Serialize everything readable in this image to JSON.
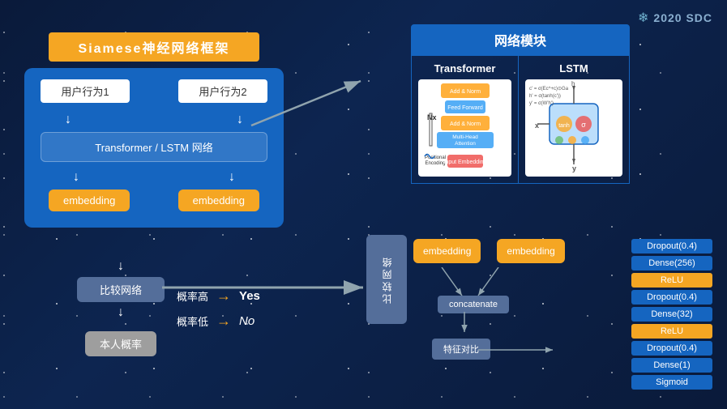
{
  "logo": {
    "icon": "❄",
    "text": "2020 SDC"
  },
  "left": {
    "siamese_title": "Siamese神经网络框架",
    "user1": "用户行为1",
    "user2": "用户行为2",
    "transformer_lstm": "Transformer / LSTM 网络",
    "embedding1": "embedding",
    "embedding2": "embedding",
    "compare_network": "比较网络",
    "prob_box": "本人概率",
    "prob_high": "概率高",
    "prob_low": "概率低",
    "yes": "Yes",
    "no": "No"
  },
  "right": {
    "title": "网络模块",
    "transformer_label": "Transformer",
    "lstm_label": "LSTM"
  },
  "compare_center": {
    "label": "比较网络"
  },
  "bottom_center": {
    "embedding1": "embedding",
    "embedding2": "embedding",
    "concatenate": "concatenate",
    "feature_compare": "特征对比"
  },
  "layers": [
    {
      "label": "Dropout(0.4)",
      "type": "blue"
    },
    {
      "label": "Dense(256)",
      "type": "blue"
    },
    {
      "label": "ReLU",
      "type": "orange"
    },
    {
      "label": "Dropout(0.4)",
      "type": "blue"
    },
    {
      "label": "Dense(32)",
      "type": "blue"
    },
    {
      "label": "ReLU",
      "type": "orange"
    },
    {
      "label": "Dropout(0.4)",
      "type": "blue"
    },
    {
      "label": "Dense(1)",
      "type": "blue"
    },
    {
      "label": "Sigmoid",
      "type": "blue"
    }
  ]
}
